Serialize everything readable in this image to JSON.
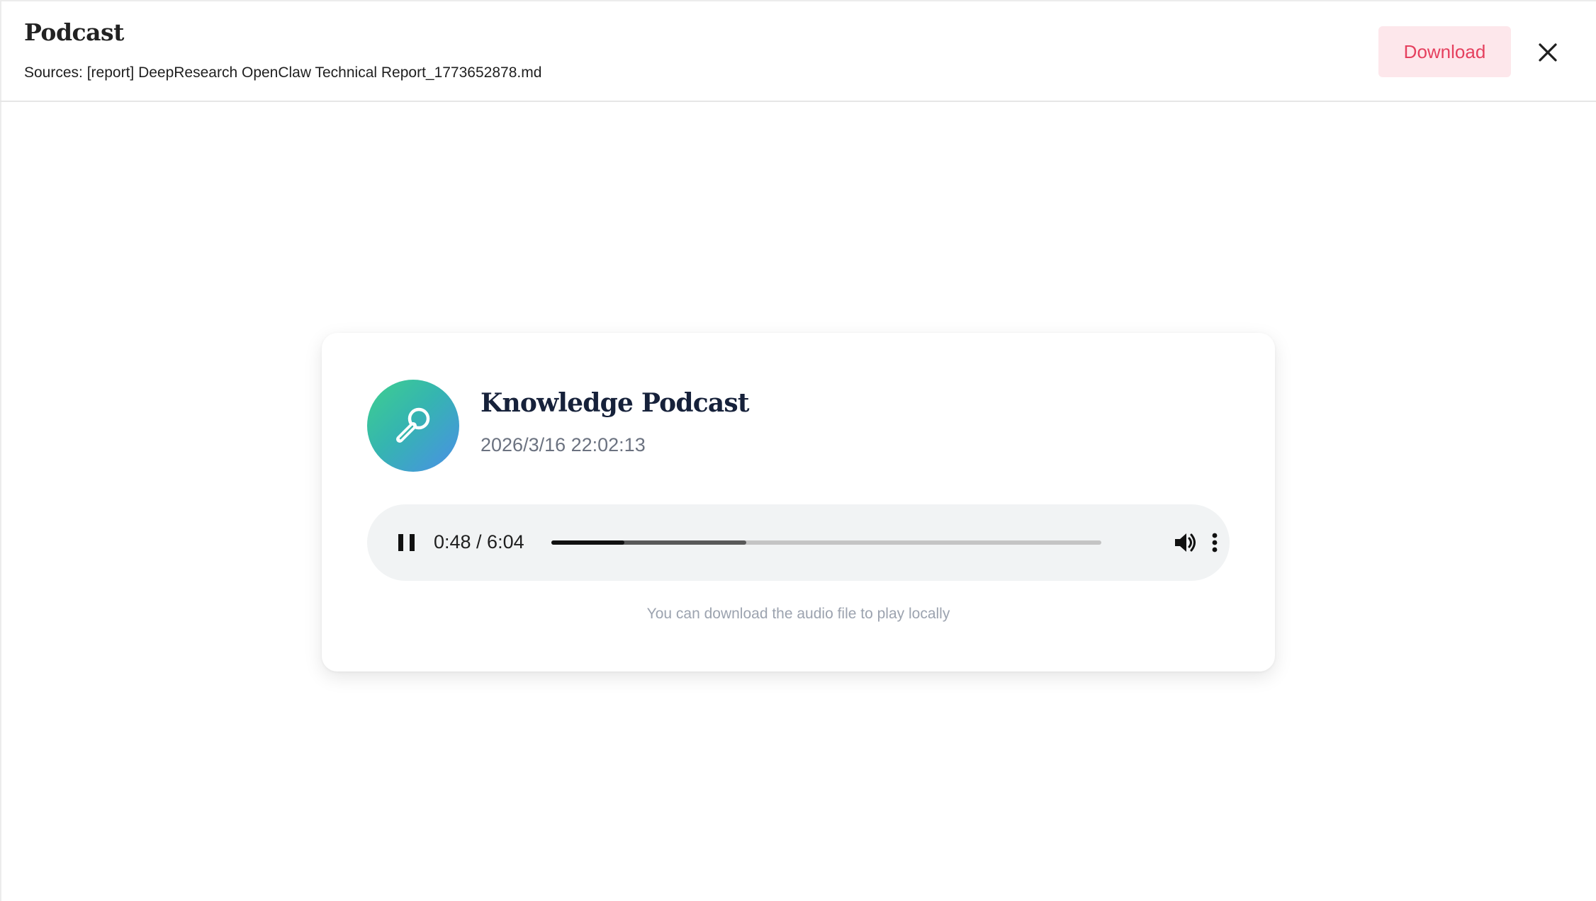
{
  "header": {
    "title": "Podcast",
    "sources": "Sources: [report] DeepResearch OpenClaw Technical Report_1773652878.md",
    "download_label": "Download"
  },
  "podcast": {
    "title": "Knowledge Podcast",
    "date": "2026/3/16 22:02:13",
    "icon": "microphone-icon"
  },
  "player": {
    "time": "0:48 / 6:04",
    "current": "0:48",
    "duration": "6:04",
    "played_fraction": 0.1324,
    "buffered_fraction": 0.355,
    "state": "playing"
  },
  "hint": "You can download the audio file to play locally",
  "colors": {
    "download_bg": "#fde7eb",
    "download_text": "#e5405e",
    "avatar_gradient_start": "#3ecf8e",
    "avatar_gradient_end": "#4a8fe7",
    "player_bg": "#f1f3f4"
  }
}
